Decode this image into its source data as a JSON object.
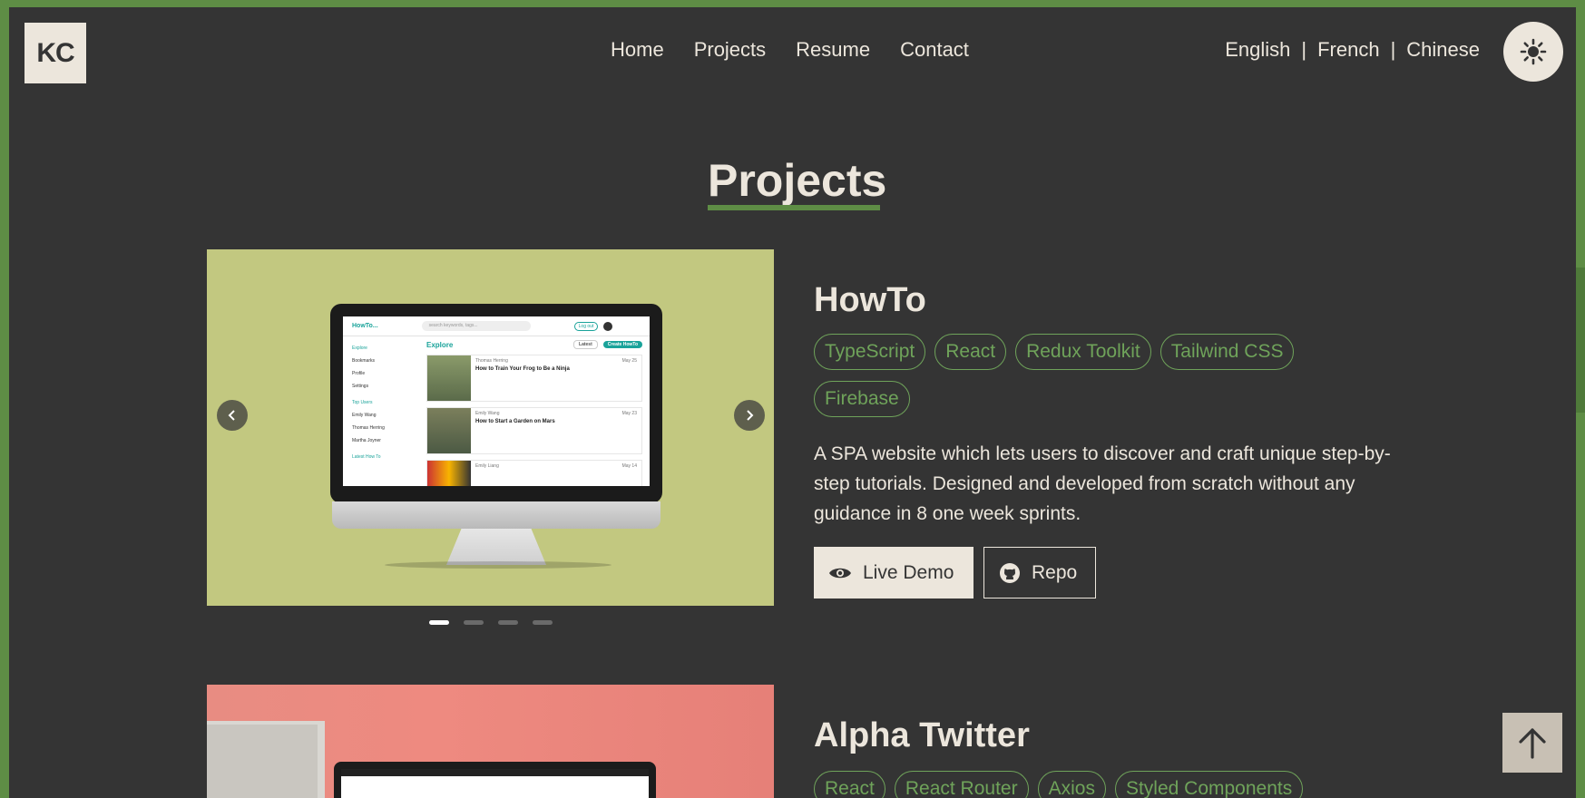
{
  "header": {
    "logo": "KC",
    "nav": [
      "Home",
      "Projects",
      "Resume",
      "Contact"
    ],
    "languages": [
      "English",
      "French",
      "Chinese"
    ],
    "separator": "|"
  },
  "page": {
    "title": "Projects"
  },
  "projects": [
    {
      "title": "HowTo",
      "tags": [
        "TypeScript",
        "React",
        "Redux Toolkit",
        "Tailwind CSS",
        "Firebase"
      ],
      "description": "A SPA website which lets users to discover and craft unique step-by-step tutorials. Designed and developed from scratch without any guidance in 8 one week sprints.",
      "buttons": {
        "demo": "Live Demo",
        "repo": "Repo"
      },
      "carousel": {
        "slides": 4,
        "active": 0
      },
      "mock": {
        "app_name": "HowTo...",
        "search_placeholder": "search keywords, tags...",
        "logout": "Log out",
        "heading": "Explore",
        "filter": "Latest",
        "create": "Create HowTo",
        "sidebar": [
          "Explore",
          "Bookmarks",
          "Profile",
          "Settings"
        ],
        "top_users_label": "Top Users",
        "top_users": [
          "Emily Wang",
          "Thomas Herring",
          "Martha Joyner"
        ],
        "latest_label": "Latest How To",
        "posts": [
          {
            "author": "Thomas Herring",
            "date": "May 25",
            "title": "How to Train Your Frog to Be a Ninja"
          },
          {
            "author": "Emily Wang",
            "date": "May 23",
            "title": "How to Start a Garden on Mars"
          },
          {
            "author": "Emily Liang",
            "date": "May 14",
            "title": ""
          }
        ]
      }
    },
    {
      "title": "Alpha Twitter",
      "tags": [
        "React",
        "React Router",
        "Axios",
        "Styled Components"
      ]
    }
  ],
  "colors": {
    "accent": "#5e8d45",
    "tag": "#6fa35a",
    "background": "#343434",
    "cream": "#ece6dc"
  }
}
